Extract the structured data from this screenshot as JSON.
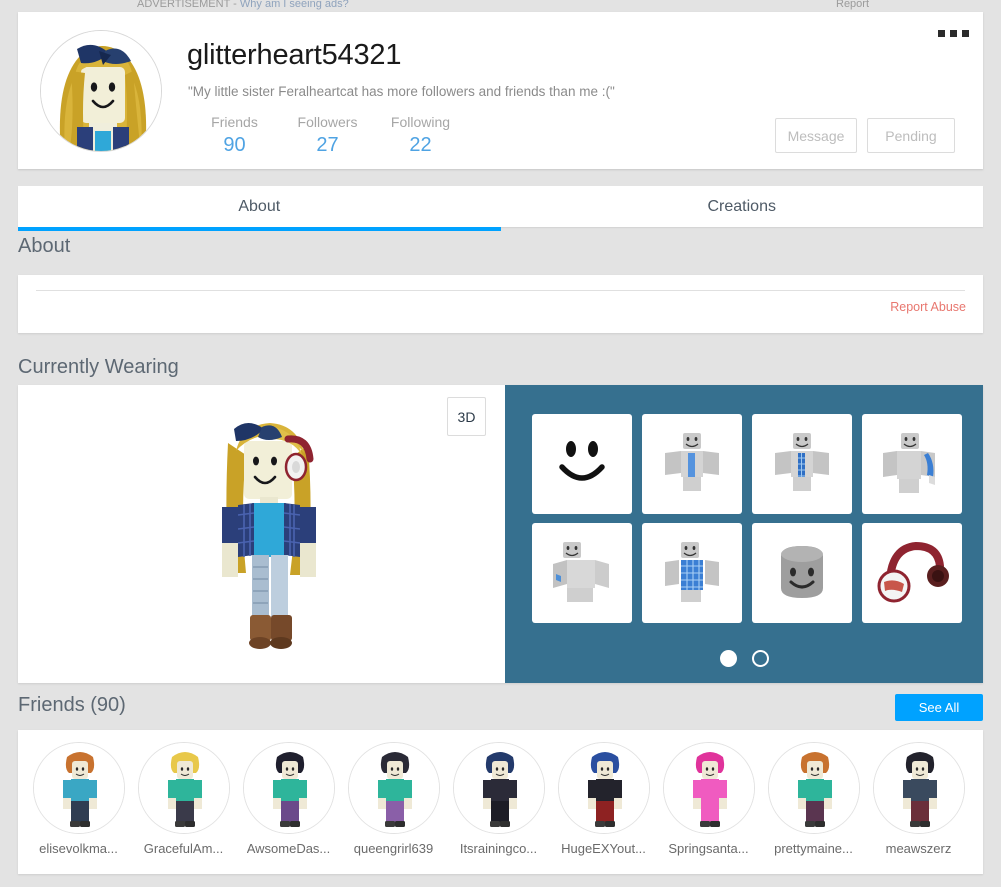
{
  "ad": {
    "label": "ADVERTISEMENT - ",
    "link": "Why am I seeing ads?",
    "report": "Report"
  },
  "profile": {
    "username": "glitterheart54321",
    "bio": "\"My little sister Feralheartcat has more followers and friends than me :(\"",
    "avatar_name": "profile-headshot",
    "stats": [
      {
        "label": "Friends",
        "value": "90"
      },
      {
        "label": "Followers",
        "value": "27"
      },
      {
        "label": "Following",
        "value": "22"
      }
    ],
    "actions": [
      {
        "label": "Message"
      },
      {
        "label": "Pending"
      }
    ],
    "menu_icon": "ellipsis-icon"
  },
  "tabs": [
    {
      "label": "About",
      "active": true
    },
    {
      "label": "Creations",
      "active": false
    }
  ],
  "about": {
    "heading": "About",
    "report_abuse": "Report Abuse"
  },
  "wearing": {
    "heading": "Currently Wearing",
    "view_3d_label": "3D",
    "items": [
      {
        "name": "item-face-smile"
      },
      {
        "name": "item-shirt-blue-tie"
      },
      {
        "name": "item-shirt-checkered-tie"
      },
      {
        "name": "item-jacket-blue-sleeve"
      },
      {
        "name": "item-shirt-plain"
      },
      {
        "name": "item-shirt-blue-checkered"
      },
      {
        "name": "item-head-gray"
      },
      {
        "name": "item-headphones-red"
      }
    ],
    "carousel": {
      "total": 2,
      "active": 1
    }
  },
  "friends": {
    "heading": "Friends (90)",
    "see_all_label": "See All",
    "list": [
      {
        "name": "elisevolkma...",
        "hair": "#c8722f",
        "shirt": "#3aa7c4",
        "pants": "#2f3d52"
      },
      {
        "name": "GracefulAm...",
        "hair": "#e8c84a",
        "shirt": "#2eb59b",
        "pants": "#3a3a4a"
      },
      {
        "name": "AwsomeDas...",
        "hair": "#1f1f2e",
        "shirt": "#2eb59b",
        "pants": "#6b4a8a"
      },
      {
        "name": "queengrirl639",
        "hair": "#2a2a36",
        "shirt": "#2eb59b",
        "pants": "#8a5fa8"
      },
      {
        "name": "Itsrainingco...",
        "hair": "#233a6b",
        "shirt": "#2b2b38",
        "pants": "#1d1d26"
      },
      {
        "name": "HugeEXYout...",
        "hair": "#2a4fa0",
        "shirt": "#23232c",
        "pants": "#8e2222"
      },
      {
        "name": "Springsanta...",
        "hair": "#e0339b",
        "shirt": "#f05bc0",
        "pants": "#f05bc0"
      },
      {
        "name": "prettymaine...",
        "hair": "#c8722f",
        "shirt": "#2eb59b",
        "pants": "#5a3550"
      },
      {
        "name": "meawszerz",
        "hair": "#22222c",
        "shirt": "#3a4a5e",
        "pants": "#6b2f3a"
      }
    ]
  },
  "colors": {
    "accent_blue": "#00a2ff",
    "stat_blue": "#4fa3e3",
    "panel_blue": "#36708f",
    "report_red": "#e8776f",
    "page_bg": "#e3e3e3"
  }
}
